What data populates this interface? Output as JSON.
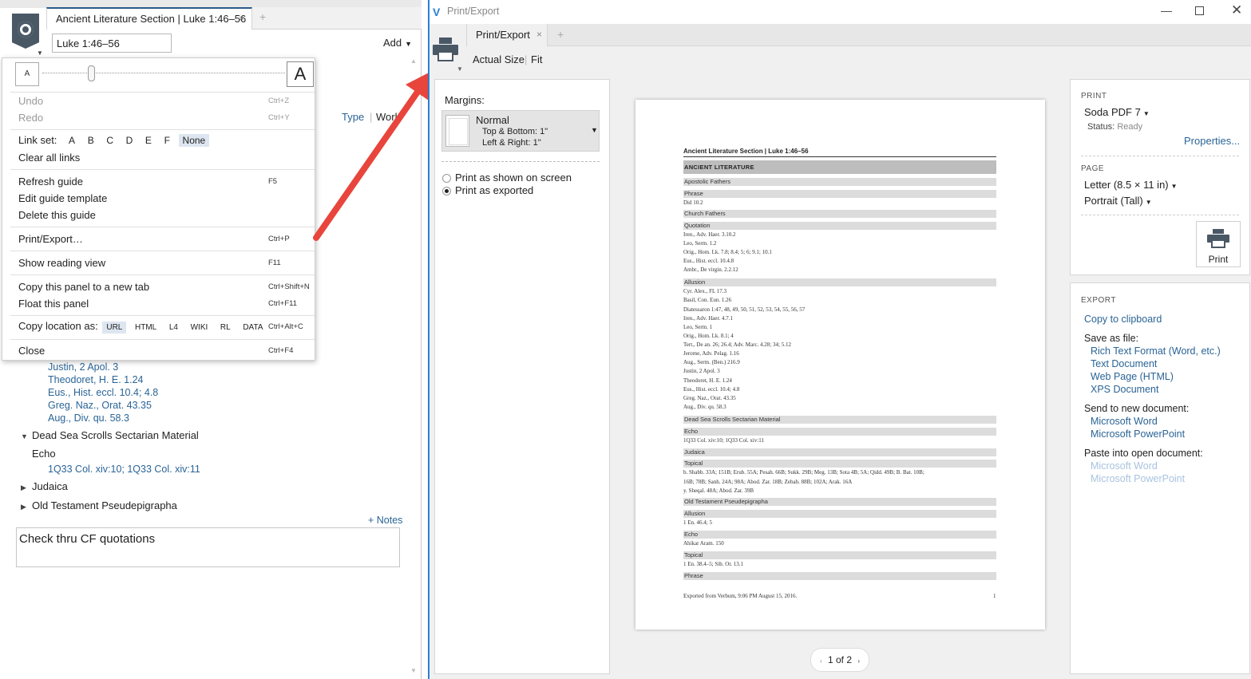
{
  "left_panel": {
    "tab_title": "Ancient Literature Section | Luke 1:46–56",
    "tab_close": "×",
    "tab_add": "+",
    "reference_value": "Luke 1:46–56",
    "add_label": "Add",
    "type_link": "Type",
    "work_link": "Work",
    "citations_top": [
      "Justin, 2 Apol. 3",
      "Theodoret, H. E. 1.24",
      "Eus., Hist. eccl. 10.4; 4.8",
      "Greg. Naz., Orat. 43.35",
      "Aug., Div. qu. 58.3"
    ],
    "section_dss": "Dead Sea Scrolls Sectarian Material",
    "echo_label": "Echo",
    "dss_citation": "1Q33 Col. xiv:10; 1Q33 Col. xiv:11",
    "section_judaica": "Judaica",
    "section_otp": "Old Testament Pseudepigrapha",
    "notes_link": "+ Notes",
    "note_text": "Check thru CF quotations"
  },
  "menu": {
    "font_small": "A",
    "font_large": "A",
    "undo": "Undo",
    "undo_sc": "Ctrl+Z",
    "redo": "Redo",
    "redo_sc": "Ctrl+Y",
    "link_set_label": "Link set:",
    "link_sets": [
      "A",
      "B",
      "C",
      "D",
      "E",
      "F",
      "None"
    ],
    "clear_links": "Clear all links",
    "refresh": "Refresh guide",
    "refresh_sc": "F5",
    "edit_template": "Edit guide template",
    "delete_guide": "Delete this guide",
    "print_export": "Print/Export…",
    "print_export_sc": "Ctrl+P",
    "reading_view": "Show reading view",
    "reading_view_sc": "F11",
    "copy_panel": "Copy this panel to a new tab",
    "copy_panel_sc": "Ctrl+Shift+N",
    "float_panel": "Float this panel",
    "float_panel_sc": "Ctrl+F11",
    "copy_location_label": "Copy location as:",
    "copy_location_opts": [
      "URL",
      "HTML",
      "L4",
      "WIKI",
      "RL",
      "DATA"
    ],
    "copy_location_sc": "Ctrl+Alt+C",
    "close": "Close",
    "close_sc": "Ctrl+F4"
  },
  "window": {
    "title": "Print/Export",
    "app_icon": "V",
    "min": "—",
    "close": "✕",
    "tab_label": "Print/Export",
    "tab_close": "×",
    "tab_add": "+",
    "actual_size": "Actual Size",
    "fit": "Fit"
  },
  "margins": {
    "label": "Margins:",
    "name": "Normal",
    "top_bottom": "Top & Bottom:  1\"",
    "left_right": "Left & Right:     1\"",
    "opt_screen": "Print as shown on screen",
    "opt_exported": "Print as exported"
  },
  "preview": {
    "title": "Ancient Literature Section | Luke 1:46–56",
    "header": "ANCIENT LITERATURE",
    "sub_apostolic": "Apostolic Fathers",
    "sub_phrase": "Phrase",
    "line_did": "Did 10.2",
    "sub_church": "Church Fathers",
    "sub_quotation": "Quotation",
    "quotation_lines": [
      "Iren., Adv. Haer. 3.10.2",
      "Leo, Serm. 1.2",
      "Orig., Hom. Lk. 7.8; 8.4; 5; 6; 9.1; 10.1",
      "Eus., Hist. eccl. 10.4.8",
      "Ambr., De virgin. 2.2.12"
    ],
    "sub_allusion": "Allusion",
    "allusion_lines": [
      "Cyr. Alex., FL 17.3",
      "Basil, Con. Eun. 1.26",
      "Diatessaron 1:47, 48, 49, 50, 51, 52, 53, 54, 55, 56, 57",
      "Iren., Adv. Haer. 4.7.1",
      "Leo, Serm. 1",
      "Orig., Hom. Lk. 8.1; 4",
      "Tert., De an. 26; 26.4; Adv. Marc. 4.28; 34; 5.12",
      "Jerome, Adv. Pelag. 1.16",
      "Aug., Serm. (Ben.) 216.9",
      "Justin, 2 Apol. 3",
      "Theodoret, H. E. 1.24",
      "Eus., Hist. eccl. 10.4; 4.8",
      "Greg. Naz., Orat. 43.35",
      "Aug., Div. qu. 58.3"
    ],
    "sub_dss": "Dead Sea Scrolls Sectarian Material",
    "sub_echo": "Echo",
    "dss_line": "1Q33 Col. xiv:10; 1Q33 Col. xiv:11",
    "sub_judaica": "Judaica",
    "sub_topical": "Topical",
    "topical_lines": [
      "b. Shabb. 33A; 151B; Erub. 55A; Pesah. 66B; Sukk. 29B; Meg. 13B; Sota 4B; 5A; Qidd. 49B; B. Bat. 10B;",
      "16B; 78B; Sanh. 24A; 98A; Abod. Zar. 18B; Zebah. 88B; 102A; Arak. 16A",
      "y. Sheqal. 48A; Abod. Zar. 39B"
    ],
    "sub_otp": "Old Testament Pseudepigrapha",
    "sub_allusion2": "Allusion",
    "otp_allusion": "1 En. 46.4; 5",
    "sub_echo2": "Echo",
    "otp_echo": "Ahikar Aram. 150",
    "sub_topical2": "Topical",
    "otp_topical": "1 En. 38.4–5; Sib. Or. 13.1",
    "sub_phrase2": "Phrase",
    "footer": "Exported from Verbum, 9:06 PM August 15, 2016.",
    "page_num": "1"
  },
  "pager": {
    "label": "1 of 2",
    "prev": "‹",
    "next": "›"
  },
  "print": {
    "heading": "PRINT",
    "printer": "Soda PDF 7",
    "status_label": "Status:",
    "status_value": "Ready",
    "properties": "Properties...",
    "page_heading": "PAGE",
    "paper": "Letter (8.5 × 11 in)",
    "orientation": "Portrait (Tall)",
    "print_button": "Print"
  },
  "export": {
    "heading": "EXPORT",
    "clipboard": "Copy to clipboard",
    "save_as": "Save as file:",
    "rtf": "Rich Text Format (Word, etc.)",
    "txt": "Text Document",
    "html": "Web Page (HTML)",
    "xps": "XPS Document",
    "send_to": "Send to new document:",
    "word": "Microsoft Word",
    "ppt": "Microsoft PowerPoint",
    "paste_into": "Paste into open document:",
    "word_dis": "Microsoft Word",
    "ppt_dis": "Microsoft PowerPoint"
  },
  "colors": {
    "accent": "#2b7fd5",
    "link": "#2a6496",
    "arrow": "#e8453c"
  }
}
